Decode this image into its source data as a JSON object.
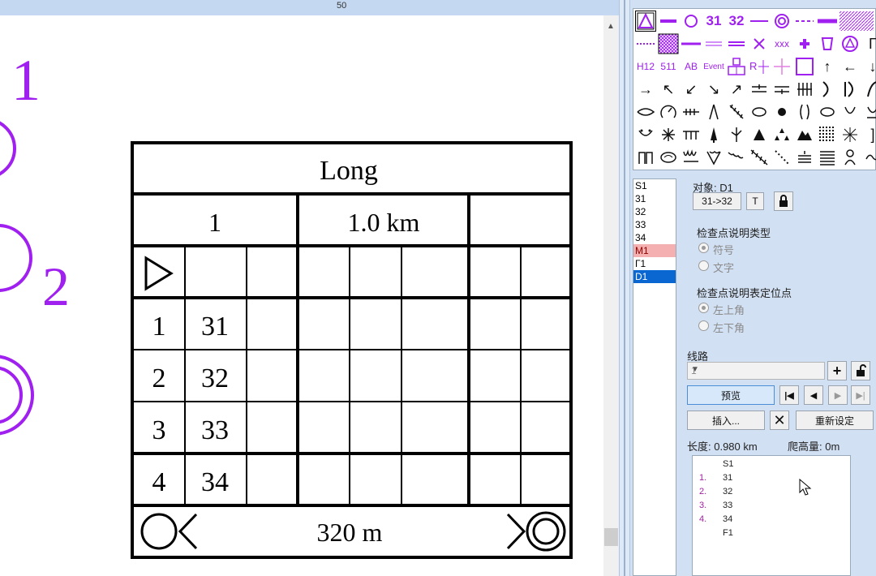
{
  "ruler": {
    "value": "50"
  },
  "map": {
    "labels": {
      "one": "1",
      "two": "2"
    }
  },
  "description_sheet": {
    "title": "Long",
    "course": "1",
    "length": "1.0 km",
    "controls": [
      {
        "seq": "1",
        "code": "31"
      },
      {
        "seq": "2",
        "code": "32"
      },
      {
        "seq": "3",
        "code": "33"
      },
      {
        "seq": "4",
        "code": "34"
      }
    ],
    "finish_distance": "320 m"
  },
  "palette": {
    "text_symbols": [
      "31",
      "32",
      "xxx",
      "H12",
      "511",
      "AB",
      "Event"
    ],
    "colors": {
      "symbol": "#a020f0",
      "alt": "#111111"
    }
  },
  "object_list": {
    "items": [
      "S1",
      "31",
      "32",
      "33",
      "34",
      "M1",
      "Г1",
      "D1"
    ],
    "selected": "D1",
    "highlighted": "M1"
  },
  "properties": {
    "object_label": "对象: D1",
    "transition_button": "31->32",
    "t_button": "T",
    "lock_icon": "lock-icon",
    "type_group": "检查点说明类型",
    "type_options": [
      "符号",
      "文字"
    ],
    "anchor_group": "检查点说明表定位点",
    "anchor_options": [
      "左上角",
      "左下角"
    ]
  },
  "route": {
    "label": "线路",
    "selected": "1",
    "preview_button": "预览",
    "insert_button": "插入...",
    "reset_button": "重新设定",
    "length_text": "长度: 0.980 km",
    "climb_text": "爬高量: 0m"
  },
  "legs_list": [
    {
      "num": "",
      "code": "S1"
    },
    {
      "num": "1.",
      "code": "31"
    },
    {
      "num": "2.",
      "code": "32"
    },
    {
      "num": "3.",
      "code": "33"
    },
    {
      "num": "4.",
      "code": "34"
    },
    {
      "num": "",
      "code": "F1"
    }
  ],
  "colors": {
    "purple": "#a020f0",
    "selected_blue": "#0a66d0",
    "panel_bg": "#d2e0f3",
    "highlight_pink": "#f4b0b0"
  }
}
